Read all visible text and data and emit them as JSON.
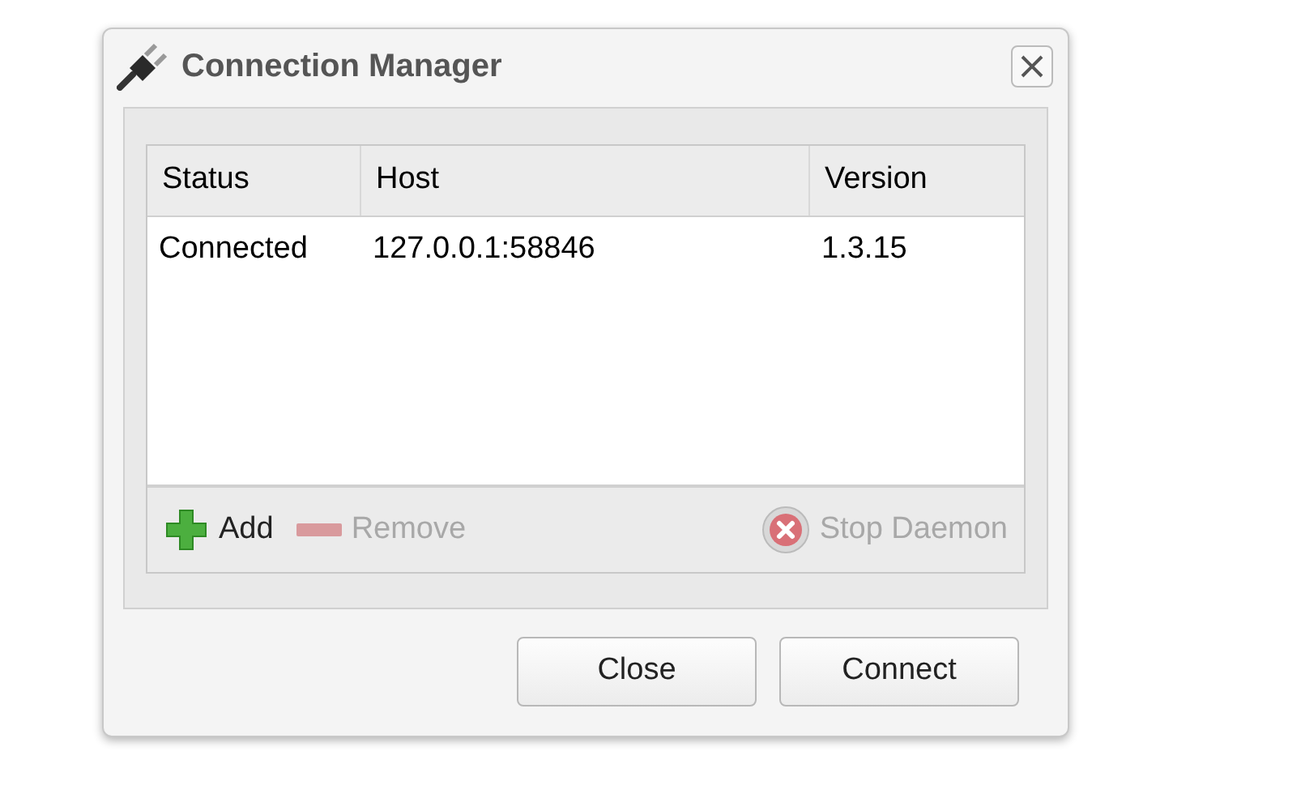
{
  "window": {
    "title": "Connection Manager"
  },
  "table": {
    "columns": [
      "Status",
      "Host",
      "Version"
    ],
    "rows": [
      {
        "cells": [
          "Connected",
          "127.0.0.1:58846",
          "1.3.15"
        ],
        "selected": false
      }
    ]
  },
  "toolbar": [
    {
      "kind": "add",
      "label": "Add",
      "disabled": false
    },
    {
      "kind": "remove",
      "label": "Remove",
      "disabled": true
    },
    {
      "kind": "stop",
      "label": "Stop Daemon",
      "disabled": true
    }
  ],
  "buttons": [
    "Close",
    "Connect"
  ]
}
